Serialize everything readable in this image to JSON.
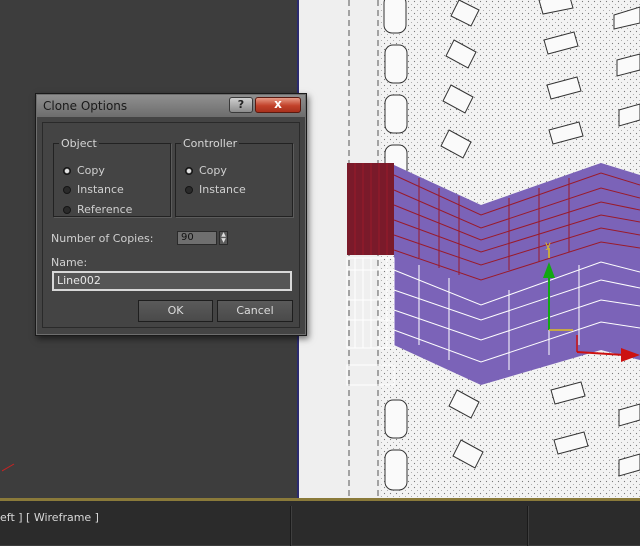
{
  "dialog": {
    "title": "Clone Options",
    "help_label": "?",
    "close_label": "x",
    "object_group": {
      "legend": "Object",
      "options": [
        {
          "label": "Copy",
          "checked": true
        },
        {
          "label": "Instance",
          "checked": false
        },
        {
          "label": "Reference",
          "checked": false
        }
      ]
    },
    "controller_group": {
      "legend": "Controller",
      "options": [
        {
          "label": "Copy",
          "checked": true
        },
        {
          "label": "Instance",
          "checked": false
        }
      ]
    },
    "copies_label": "Number of Copies:",
    "copies_value": "90",
    "name_label": "Name:",
    "name_value": "Line002",
    "ok_label": "OK",
    "cancel_label": "Cancel"
  },
  "viewport": {
    "label": "eft ] [ Wireframe ]",
    "gizmo_y_label": "y",
    "colors": {
      "selection": "#7b63b8",
      "edge_selected": "#8b1020",
      "gizmo_y": "#12a812",
      "gizmo_x": "#cc1111",
      "gizmo_yellow": "#e0c020"
    }
  }
}
